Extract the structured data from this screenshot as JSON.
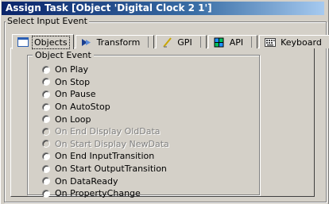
{
  "window": {
    "title": "Assign Task [Object 'Digital Clock 2 1']",
    "group_label": "Select Input Event"
  },
  "tabs": [
    {
      "label": "Objects",
      "icon": "objects-icon",
      "active": true
    },
    {
      "label": "Transform",
      "icon": "transform-icon",
      "active": false
    },
    {
      "label": "GPI",
      "icon": "gpi-icon",
      "active": false
    },
    {
      "label": "API",
      "icon": "api-icon",
      "active": false
    },
    {
      "label": "Keyboard",
      "icon": "keyboard-icon",
      "active": false
    }
  ],
  "object_event": {
    "label": "Object Event",
    "options": [
      {
        "label": "On Play",
        "enabled": true
      },
      {
        "label": "On Stop",
        "enabled": true
      },
      {
        "label": "On Pause",
        "enabled": true
      },
      {
        "label": "On AutoStop",
        "enabled": true
      },
      {
        "label": "On Loop",
        "enabled": true
      },
      {
        "label": "On End Display OldData",
        "enabled": false
      },
      {
        "label": "On Start Display NewData",
        "enabled": false
      },
      {
        "label": "On End InputTransition",
        "enabled": true
      },
      {
        "label": "On Start OutputTransition",
        "enabled": true
      },
      {
        "label": "On DataReady",
        "enabled": true
      },
      {
        "label": "On PropertyChange",
        "enabled": true
      }
    ]
  },
  "colors": {
    "title_gradient_start": "#0a246a",
    "title_gradient_end": "#a6caf0",
    "dialog_face": "#d4d0c8",
    "disabled_text": "#808080"
  }
}
